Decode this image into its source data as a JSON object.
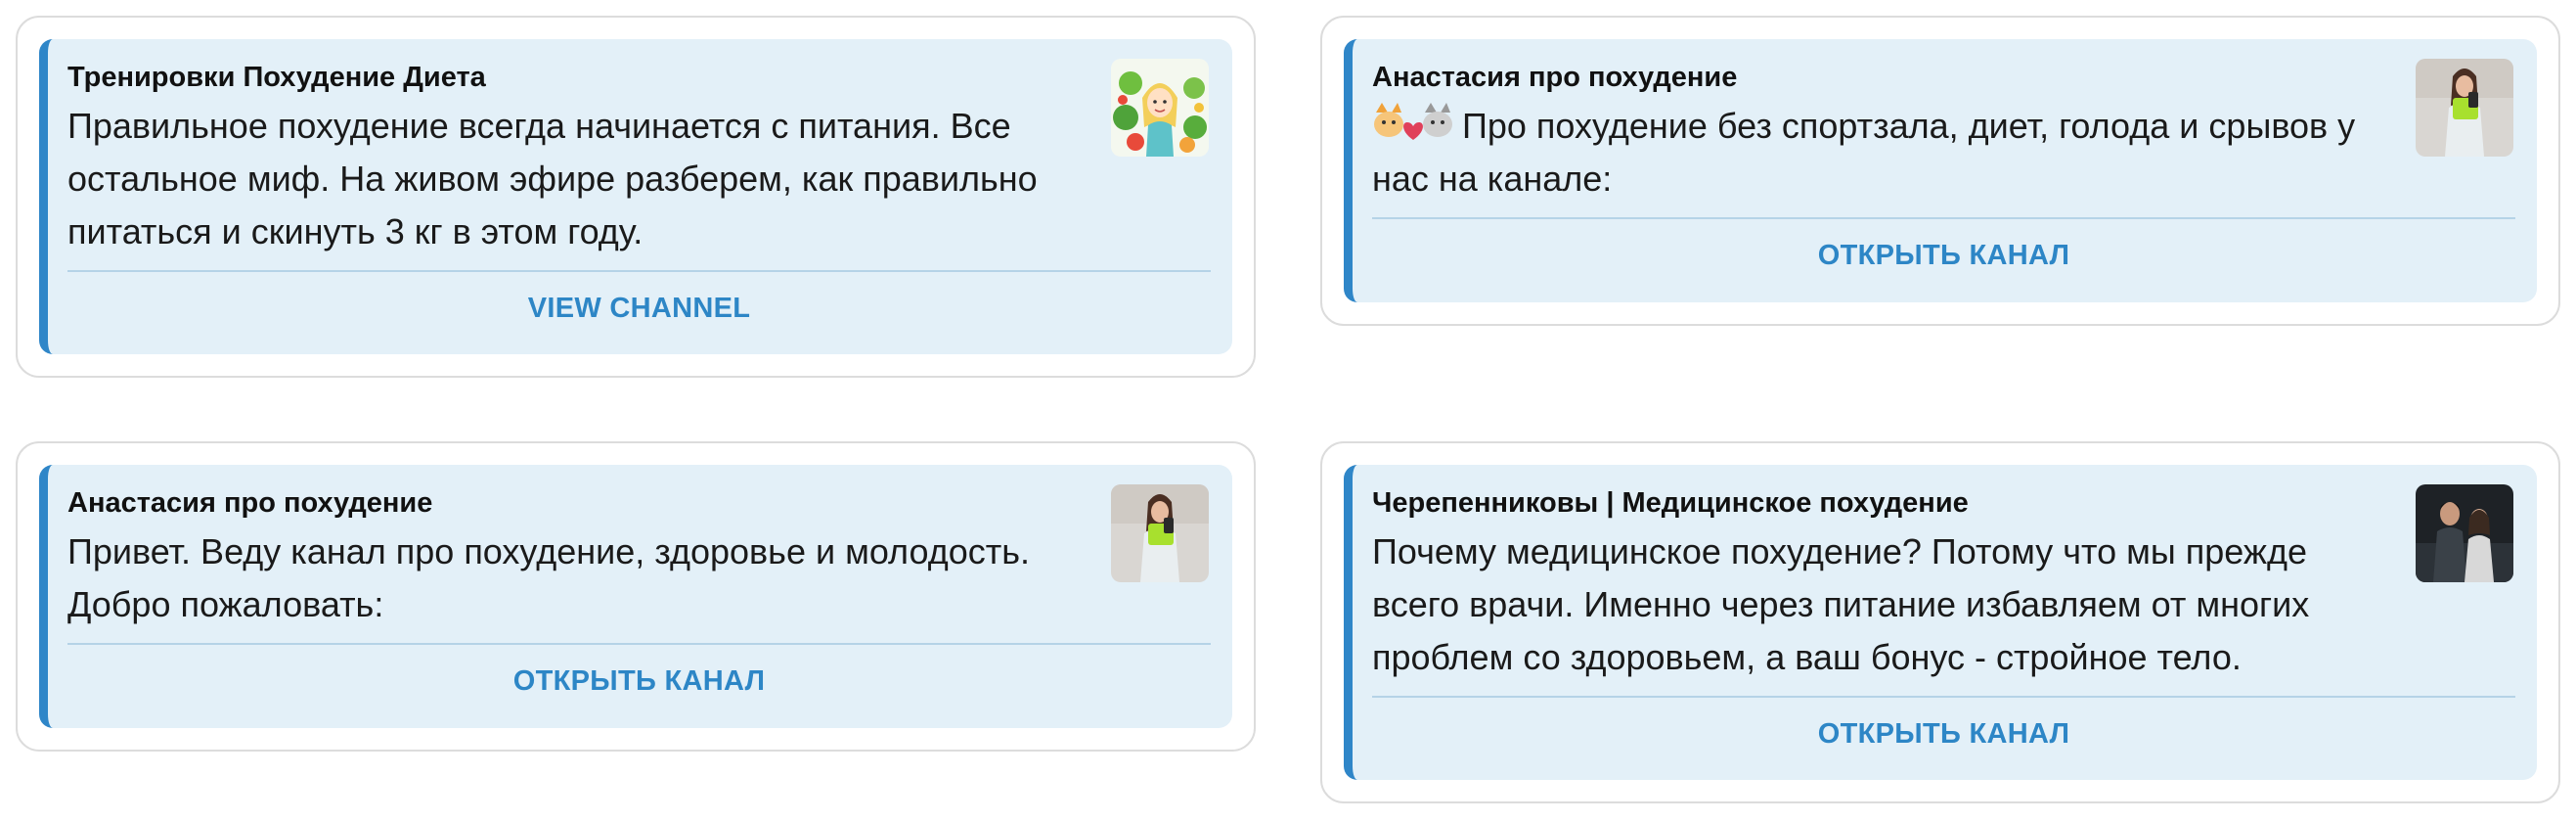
{
  "cards": [
    {
      "title": "Тренировки Похудение Диета",
      "text": "Правильное похудение всегда начинается с питания. Все остальное миф. На живом эфире разберем, как правильно питаться и скинуть 3 кг в этом году.",
      "button": "VIEW CHANNEL",
      "avatar": "cartoon-girl-salad-avatar"
    },
    {
      "title": "Анастасия про похудение",
      "text": "Про похудение без спортзала, диет, голода и срывов у нас на канале:",
      "emoji": "cats-with-heart-emoji",
      "button": "ОТКРЫТЬ КАНАЛ",
      "avatar": "woman-selfie-avatar"
    },
    {
      "title": "Анастасия про похудение",
      "text": "Привет. Веду канал про похудение, здоровье и молодость. Добро пожаловать:",
      "button": "ОТКРЫТЬ КАНАЛ",
      "avatar": "woman-selfie-avatar"
    },
    {
      "title": "Черепенниковы | Медицинское похудение",
      "text": "Почему медицинское похудение? Потому что мы прежде всего врачи. Именно через питание избавляем от многих проблем со здоровьем, а ваш бонус - стройное тело.",
      "button": "ОТКРЫТЬ КАНАЛ",
      "avatar": "couple-photo-avatar"
    }
  ],
  "colors": {
    "accent": "#2f86c8",
    "link": "#2d86c6",
    "message_bg": "#e3f0f8",
    "divider": "#b5d3e7"
  }
}
